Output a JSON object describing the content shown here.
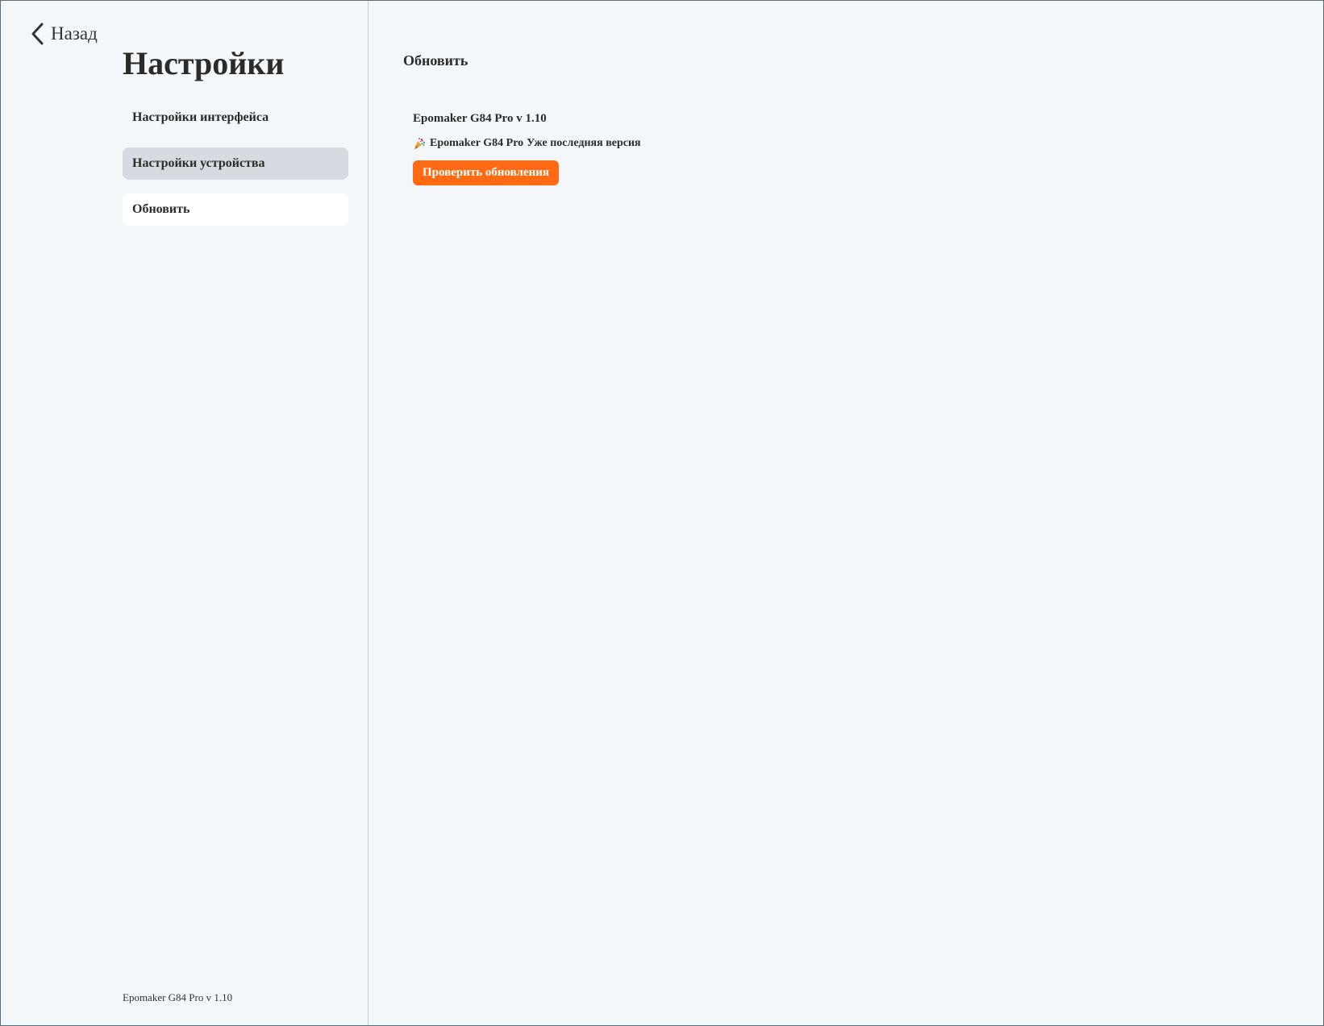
{
  "sidebar": {
    "back_label": "Назад",
    "title": "Настройки",
    "items": [
      {
        "label": "Настройки интерфейса"
      },
      {
        "label": "Настройки устройства"
      },
      {
        "label": "Обновить"
      }
    ],
    "footer_version": "Epomaker G84 Pro v 1.10"
  },
  "main": {
    "section_title": "Обновить",
    "device_version": "Epomaker G84 Pro v 1.10",
    "status": {
      "icon": "party-popper-icon",
      "device": "Epomaker G84 Pro",
      "text": "Уже последняя версия"
    },
    "check_button_label": "Проверить обновления"
  },
  "colors": {
    "accent": "#ff6a13",
    "background": "#f3f7fa",
    "nav_hover": "#d7dae0",
    "nav_active": "#ffffff"
  }
}
